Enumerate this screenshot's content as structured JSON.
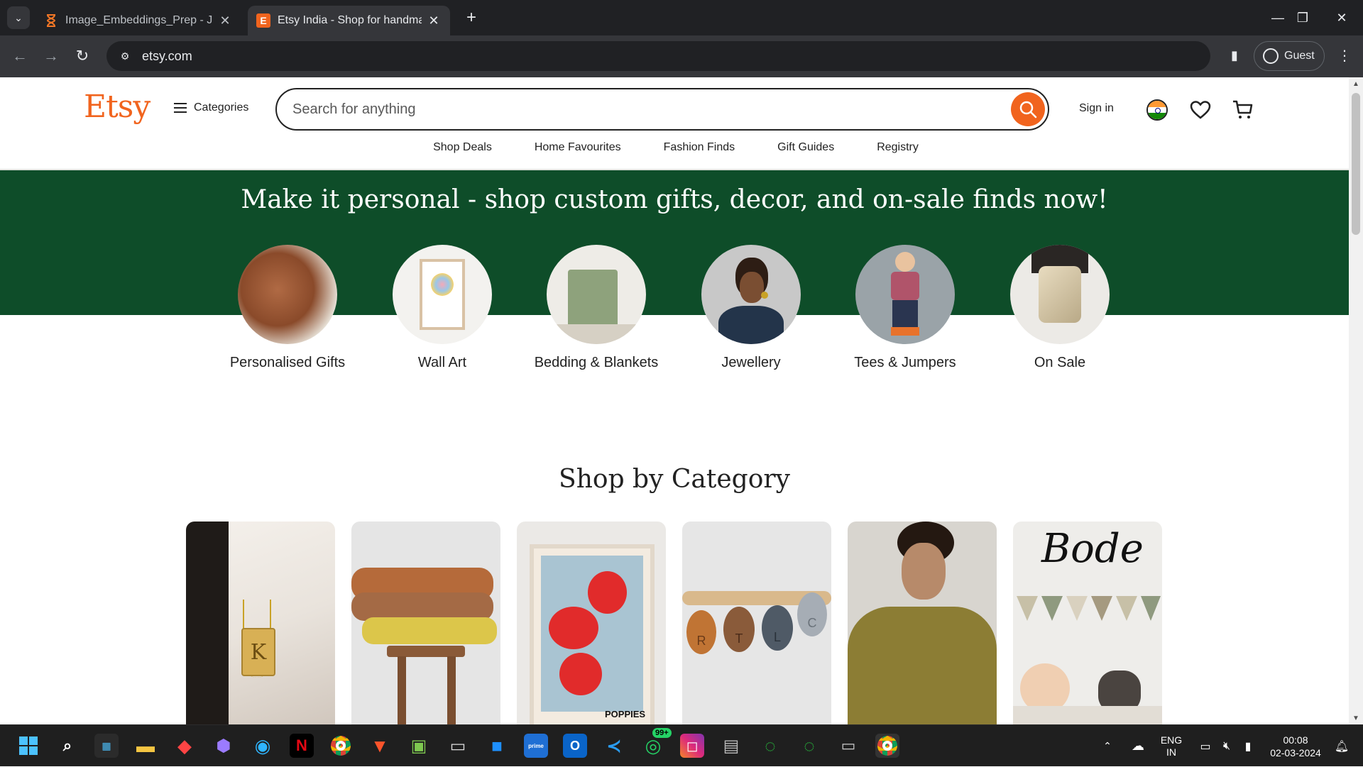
{
  "browser": {
    "tabs": [
      {
        "title": "Image_Embeddings_Prep - Jupyter",
        "favicon": "hourglass-icon"
      },
      {
        "title": "Etsy India - Shop for handmade",
        "favicon": "etsy-e-icon",
        "favicon_letter": "E"
      }
    ],
    "url": "etsy.com",
    "profile_label": "Guest"
  },
  "header": {
    "logo": "Etsy",
    "categories_label": "Categories",
    "search_placeholder": "Search for anything",
    "signin_label": "Sign in"
  },
  "subnav": [
    "Shop Deals",
    "Home Favourites",
    "Fashion Finds",
    "Gift Guides",
    "Registry"
  ],
  "hero": {
    "title": "Make it personal - shop custom gifts, decor, and on-sale finds now!",
    "circles": [
      "Personalised Gifts",
      "Wall Art",
      "Bedding & Blankets",
      "Jewellery",
      "Tees & Jumpers",
      "On Sale"
    ]
  },
  "shop_by_category": {
    "title": "Shop by Category",
    "card_texts": {
      "poster": "POPPIES",
      "sign": "Bode",
      "pendant_letter": "K",
      "keychain_letters": [
        "R",
        "T",
        "L",
        "C"
      ]
    }
  },
  "taskbar": {
    "whatsapp_badge": "99+",
    "lang_line1": "ENG",
    "lang_line2": "IN",
    "time": "00:08",
    "date": "02-03-2024"
  },
  "colors": {
    "etsy_orange": "#f1641e",
    "hero_green": "#0e4d29"
  }
}
